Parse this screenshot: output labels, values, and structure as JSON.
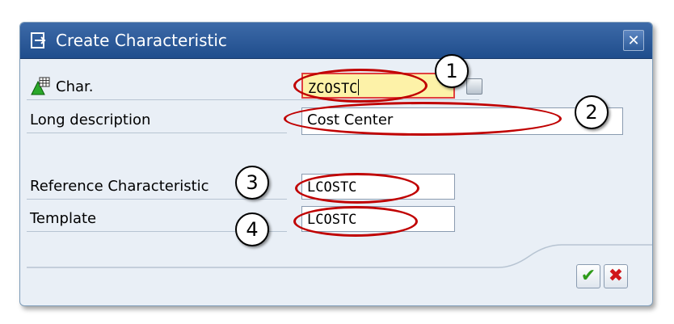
{
  "dialog": {
    "title": "Create Characteristic",
    "close_glyph": "✕"
  },
  "fields": [
    {
      "label": "Char.",
      "value": "ZCOSTC",
      "required": true
    },
    {
      "label": "Long description",
      "value": "Cost Center"
    },
    {
      "label": "Reference Characteristic",
      "value": "LCOSTC"
    },
    {
      "label": "Template",
      "value": "LCOSTC"
    }
  ],
  "callouts": [
    "1",
    "2",
    "3",
    "4"
  ],
  "footer": {
    "ok_glyph": "✔",
    "cancel_glyph": "✖"
  },
  "colors": {
    "title_bar": "#2b5896",
    "dialog_bg": "#e9eff6",
    "required_bg": "#fdf2a8",
    "highlight": "#c00000",
    "ok_green": "#2e9b1a",
    "cancel_red": "#d0161a"
  },
  "icons": {
    "title": "create-document-icon",
    "char": "characteristic-icon",
    "close": "close-icon",
    "ok": "checkmark-icon",
    "cancel": "cancel-icon",
    "help": "value-help-icon"
  }
}
